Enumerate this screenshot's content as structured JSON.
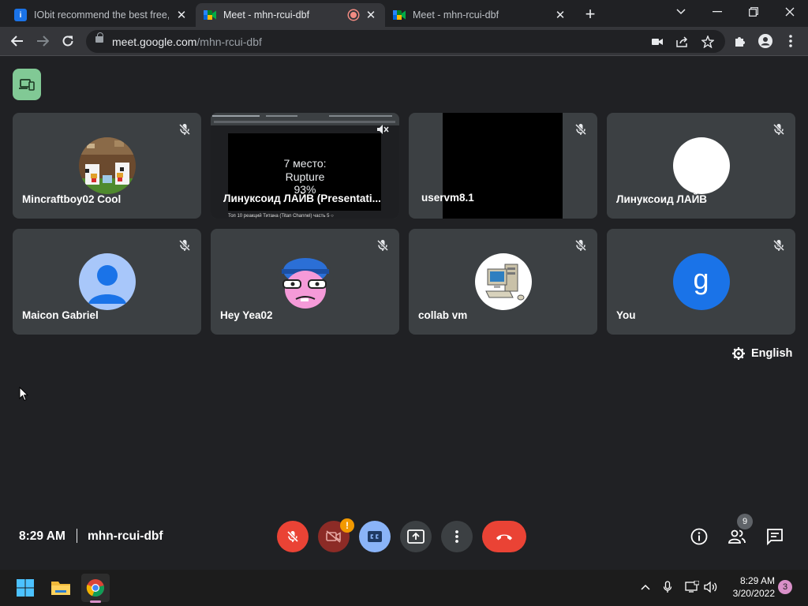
{
  "browser": {
    "tabs": [
      {
        "title": "IObit recommend the best free, f",
        "favicon": "iobit-icon",
        "active": false
      },
      {
        "title": "Meet - mhn-rcui-dbf",
        "favicon": "google-meet-icon",
        "active": true,
        "recording": true
      },
      {
        "title": "Meet - mhn-rcui-dbf",
        "favicon": "google-meet-icon",
        "active": false
      }
    ],
    "url_host": "meet.google.com",
    "url_path": "/mhn-rcui-dbf"
  },
  "participants": [
    {
      "name": "Mincraftboy02 Cool",
      "avatar": "minecraft-chickens-photo",
      "muted": true
    },
    {
      "name": "Линуксоид ЛАЙВ (Presentati...",
      "presentation": true,
      "muted": true
    },
    {
      "name": "uservm8.1",
      "video": "black-video",
      "muted": true
    },
    {
      "name": "Линуксоид ЛАЙВ",
      "avatar": "white-circle",
      "muted": true
    },
    {
      "name": "Maicon Gabriel",
      "avatar": "default-person-avatar",
      "muted": true
    },
    {
      "name": "Hey Yea02",
      "avatar": "cartoon-character-avatar",
      "muted": true
    },
    {
      "name": "collab vm",
      "avatar": "computer-clipart-avatar",
      "muted": true
    },
    {
      "name": "You",
      "avatar_letter": "g",
      "avatar_color": "#1a73e8",
      "muted": true
    }
  ],
  "presentation": {
    "lines": [
      "7 место:",
      "Rupture",
      "93%"
    ],
    "caption": "Топ 10 реакций Титана (Titan Channel) часть 5 ○"
  },
  "caption_language": "English",
  "meeting": {
    "time": "8:29 AM",
    "code": "mhn-rcui-dbf",
    "camera_warning": "!",
    "people_count": "9"
  },
  "colors": {
    "meet_bg": "#202124",
    "tile_bg": "#3c4043",
    "danger_red": "#ea4335",
    "cc_blue": "#8ab4f8",
    "present_green": "#81c995"
  },
  "taskbar": {
    "time": "8:29 AM",
    "date": "3/20/2022",
    "notifications": "3"
  }
}
